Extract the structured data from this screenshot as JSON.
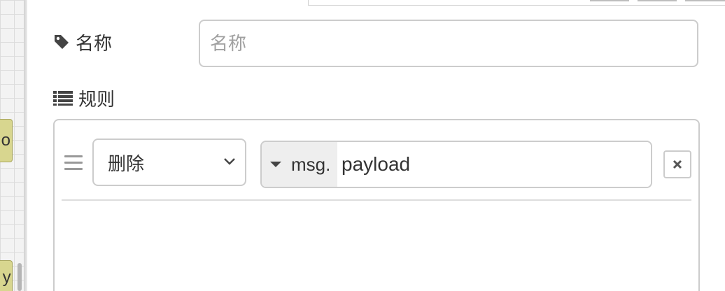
{
  "workspace": {
    "node1_label": "o",
    "node2_label": "yl"
  },
  "name_field": {
    "label": "名称",
    "placeholder": "名称",
    "value": ""
  },
  "rules": {
    "label": "规则",
    "items": [
      {
        "action": "删除",
        "type_prefix": "msg.",
        "value": "payload"
      }
    ]
  },
  "icons": {
    "name_icon": "tag-icon",
    "rules_icon": "list-icon",
    "drag_icon": "bars-icon",
    "select_icon": "chevron-down-icon",
    "type_icon": "caret-down-icon",
    "remove_icon": "close-icon"
  },
  "colors": {
    "node_fill": "#d8d68f",
    "border": "#cccccc",
    "type_button_bg": "#eeeeee"
  }
}
